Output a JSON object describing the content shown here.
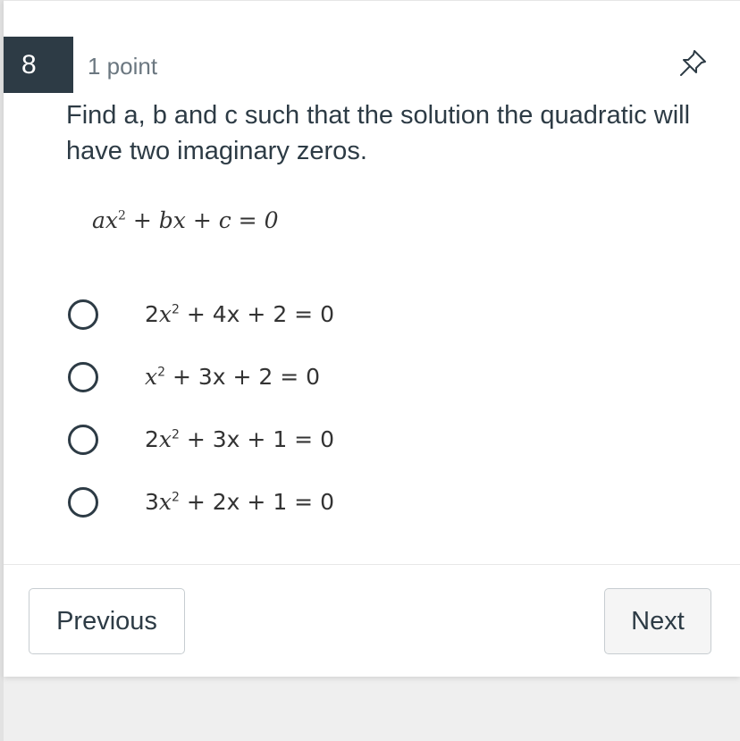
{
  "question": {
    "number": "8",
    "points": "1 point",
    "prompt": "Find a, b and c such that the solution the quadratic will have two imaginary zeros.",
    "formula": {
      "t1": "ax",
      "exp": "2",
      "rest": " + bx + c = 0"
    }
  },
  "options": [
    {
      "coef": "2",
      "var": "x",
      "exp": "2",
      "rest": " + 4x + 2 = 0"
    },
    {
      "coef": "",
      "var": "x",
      "exp": "2",
      "rest": " + 3x + 2 = 0"
    },
    {
      "coef": "2",
      "var": "x",
      "exp": "2",
      "rest": " + 3x + 1 = 0"
    },
    {
      "coef": "3",
      "var": "x",
      "exp": "2",
      "rest": " + 2x + 1 = 0"
    }
  ],
  "nav": {
    "previous_label": "Previous",
    "next_label": "Next"
  },
  "icons": {
    "pin": "pin-icon"
  },
  "colors": {
    "header_badge": "#2d3b45",
    "text": "#2d3b45",
    "muted": "#6b7780"
  }
}
